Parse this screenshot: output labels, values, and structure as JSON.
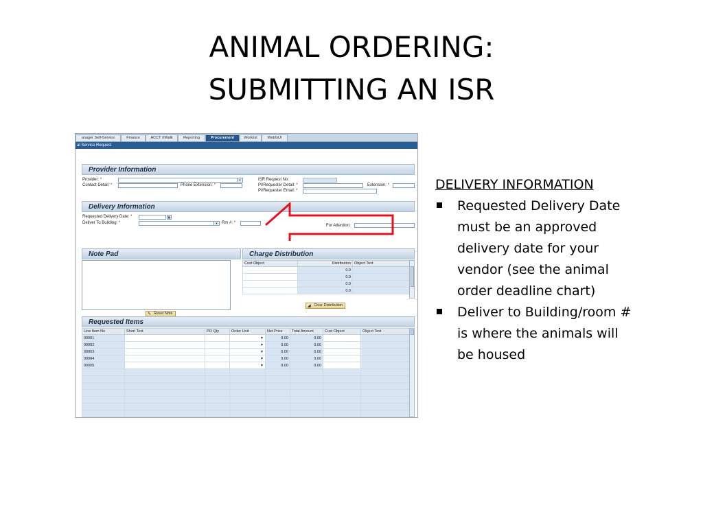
{
  "slide": {
    "title_line1": "ANIMAL ORDERING:",
    "title_line2": "SUBMITTING AN ISR"
  },
  "app": {
    "tabs": [
      "anager Self-Service",
      "Finance",
      "ACCT XWalk",
      "Reporting",
      "Procurement",
      "Worklist",
      "WebGUI"
    ],
    "active_tab": "Procurement",
    "page_title": "al Service Request",
    "provider_info": {
      "header": "Provider Information",
      "provider_label": "Provider:",
      "contact_label": "Contact Detail:",
      "phone_ext_label": "Phone Extension:",
      "isr_no_label": "ISR Request No:",
      "pi_detail_label": "PI/Requester Detail:",
      "pi_email_label": "PI/Requester Email:",
      "extension_label": "Extension:",
      "required_mark": "*"
    },
    "delivery_info": {
      "header": "Delivery Information",
      "req_date_label": "Requested Delivery Date:",
      "deliver_building_label": "Deliver To Building:",
      "rm_label": "Rm #:",
      "attention_label": "For Attention:"
    },
    "note_pad": {
      "header": "Note Pad",
      "reset_button": "Reset Note"
    },
    "charge_distribution": {
      "header": "Charge Distribution",
      "columns": [
        "Cost Object",
        "Distribution",
        "Object Text"
      ],
      "rows": [
        {
          "distribution": "0.0"
        },
        {
          "distribution": "0.0"
        },
        {
          "distribution": "0.0"
        },
        {
          "distribution": "0.0"
        }
      ],
      "clear_button": "Clear Distribution"
    },
    "requested_items": {
      "header": "Requested Items",
      "columns": [
        "Line Item No",
        "Short Text",
        "PO Qty",
        "Order Unit",
        "Net Price",
        "Total Amount",
        "Cost Object",
        "Object Text"
      ],
      "rows": [
        {
          "line": "00001",
          "net_price": "0.00",
          "total": "0.00"
        },
        {
          "line": "00002",
          "net_price": "0.00",
          "total": "0.00"
        },
        {
          "line": "00003",
          "net_price": "0.00",
          "total": "0.00"
        },
        {
          "line": "00004",
          "net_price": "0.00",
          "total": "0.00"
        },
        {
          "line": "00005",
          "net_price": "0.00",
          "total": "0.00"
        }
      ]
    }
  },
  "info": {
    "heading": "DELIVERY INFORMATION",
    "bullet1_lines": [
      "Requested Delivery Date",
      "must be an approved",
      "delivery date for your",
      "vendor (see the animal",
      "order deadline chart)"
    ],
    "bullet2_lines": [
      "Deliver to Building/room #",
      "is where the animals will",
      "be housed"
    ]
  },
  "colors": {
    "accent_blue": "#2a5d94",
    "callout_red": "#e0141e"
  },
  "icons": {
    "dropdown": "triangle-down",
    "calendar": "calendar-icon",
    "bullet": "square-bullet"
  }
}
